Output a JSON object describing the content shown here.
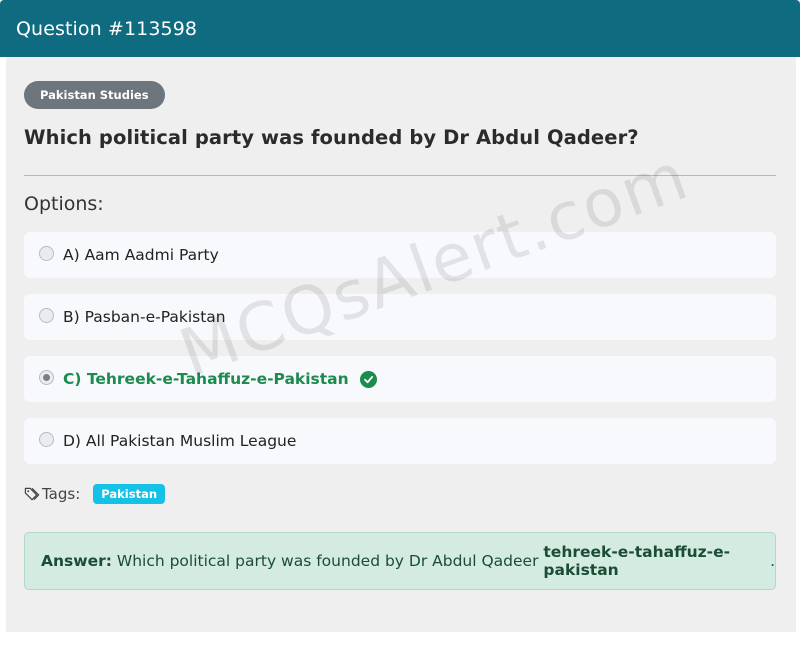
{
  "header": {
    "title": "Question #113598"
  },
  "question": {
    "subject": "Pakistan Studies",
    "text": "Which political party was founded by Dr Abdul Qadeer?"
  },
  "options_heading": "Options:",
  "options": [
    {
      "label": "A) Aam Aadmi Party",
      "selected": false,
      "correct": false
    },
    {
      "label": "B) Pasban-e-Pakistan",
      "selected": false,
      "correct": false
    },
    {
      "label": "C) Tehreek-e-Tahaffuz-e-Pakistan",
      "selected": true,
      "correct": true
    },
    {
      "label": "D) All Pakistan Muslim League",
      "selected": false,
      "correct": false
    }
  ],
  "watermark": "MCQsAlert.com",
  "tags": {
    "label": "Tags:",
    "items": [
      "Pakistan"
    ]
  },
  "answer": {
    "prefix": "Answer:",
    "text": " Which political party was founded by Dr Abdul Qadeer ",
    "value": "tehreek-e-tahaffuz-e-pakistan",
    "suffix": "."
  },
  "colors": {
    "header_bg": "#0e6b80",
    "correct": "#1d8a4e",
    "tag_pill": "#14c2e8",
    "answer_bg": "#d4ebe1"
  }
}
